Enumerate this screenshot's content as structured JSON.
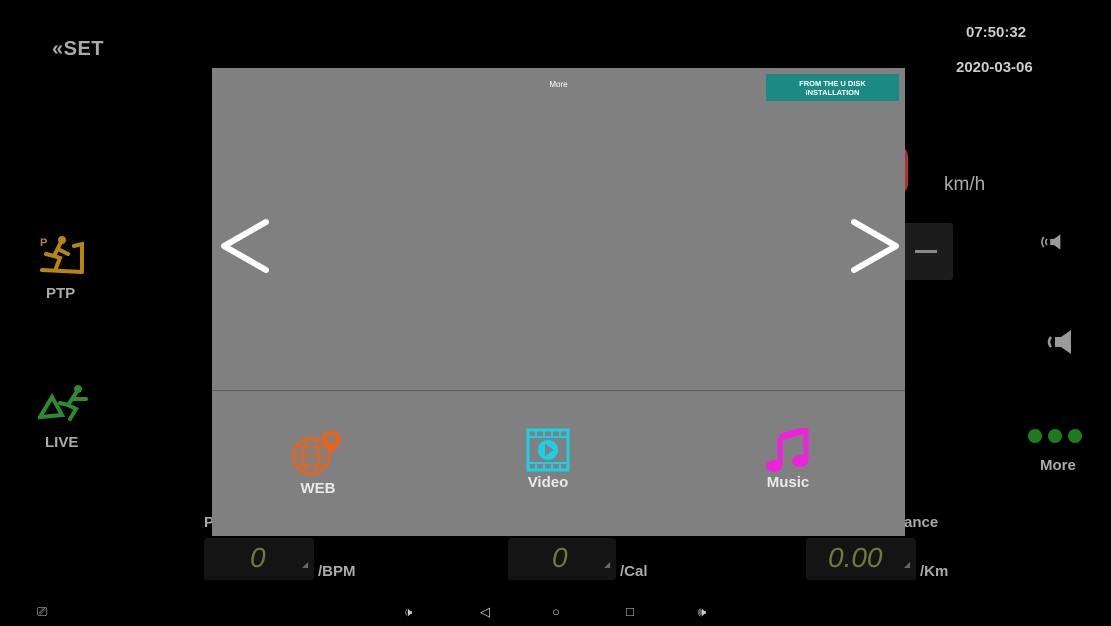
{
  "status": {
    "time": "07:50:32",
    "date": "2020-03-06"
  },
  "header": {
    "set_label": "SET"
  },
  "speed": {
    "unit": "km/h"
  },
  "sidebar_left": {
    "ptp_label": "PTP",
    "live_label": "LIVE"
  },
  "sidebar_right": {
    "more_label": "More"
  },
  "stats": {
    "heart_rate": {
      "value": "0",
      "unit": "/BPM",
      "partial_label": "P"
    },
    "calories": {
      "value": "0",
      "unit": "/Cal"
    },
    "distance": {
      "value": "0.00",
      "unit": "/Km",
      "partial_label": "ance"
    }
  },
  "modal": {
    "title": "More",
    "usb_button": "FROM THE U DISK INSTALLATION",
    "apps": [
      {
        "label": "WEB",
        "icon": "web-globe-icon",
        "color": "#e8631a"
      },
      {
        "label": "Video",
        "icon": "video-film-icon",
        "color": "#19d0e6"
      },
      {
        "label": "Music",
        "icon": "music-note-icon",
        "color": "#ee22dd"
      }
    ]
  },
  "colors": {
    "accent_teal": "#1b8a82",
    "modal_bg": "#808080",
    "status_green": "#1e7a1e",
    "ptp_gold": "#b8860b",
    "live_green": "#2e8b2e"
  }
}
